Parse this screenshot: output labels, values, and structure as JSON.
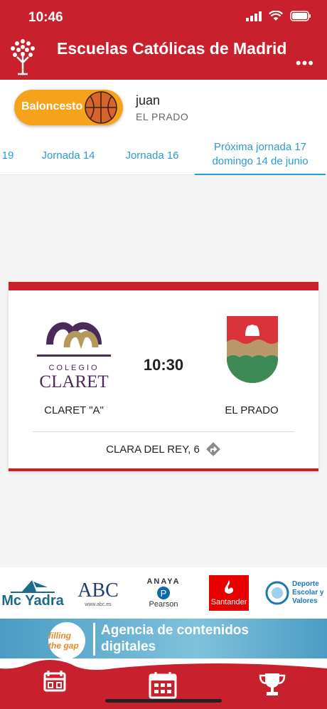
{
  "status_bar": {
    "time": "10:46"
  },
  "header": {
    "title": "Escuelas Católicas de Madrid",
    "more_label": "•••"
  },
  "team": {
    "sport": "Baloncesto",
    "user_name": "juan",
    "club": "EL PRADO"
  },
  "tabs": [
    {
      "label": "19"
    },
    {
      "label": "Jornada 14"
    },
    {
      "label": "Jornada 16"
    },
    {
      "label": "Próxima jornada 17",
      "sub": "domingo 14 de junio",
      "selected": true
    }
  ],
  "match": {
    "home_crest_text_top": "COLEGIO",
    "home_crest_text_bottom": "CLARET",
    "time": "10:30",
    "home": "CLARET \"A\"",
    "away": "EL PRADO",
    "venue": "CLARA DEL REY, 6"
  },
  "sponsors": {
    "mcyadra": "Mc Yadra",
    "abc": "ABC",
    "abc_sub": "www.abc.es",
    "anaya": "ANAYA",
    "pearson": "Pearson",
    "santander": "Santander",
    "deporte": "Deporte Escolar y Valores"
  },
  "banner": {
    "logo": "filling the gap",
    "text_line1": "Agencia de contenidos",
    "text_line2": "digitales"
  },
  "colors": {
    "brand_red": "#c8202c",
    "accent_blue": "#2b9bd3",
    "sport_orange": "#f7a21b"
  }
}
